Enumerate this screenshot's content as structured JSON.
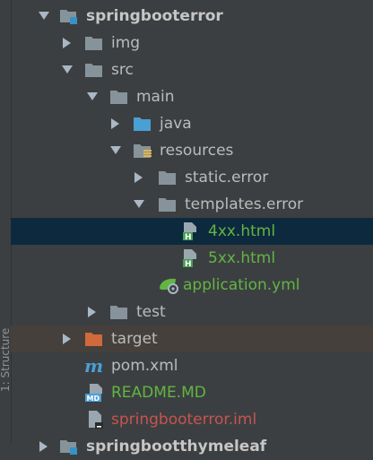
{
  "sidebar": {
    "label": "1: Structure"
  },
  "tree": {
    "root": "springbooterror",
    "img": "img",
    "src": "src",
    "main": "main",
    "java": "java",
    "resources": "resources",
    "static_error": "static.error",
    "templates_error": "templates.error",
    "file_4xx": "4xx.html",
    "file_5xx": "5xx.html",
    "application_yml": "application.yml",
    "test": "test",
    "target": "target",
    "pom": "pom.xml",
    "readme": "README.MD",
    "iml": "springbooterror.iml",
    "next_module": "springbootthymeleaf"
  },
  "colors": {
    "background": "#3c3f41",
    "selected_row": "#0d293e",
    "target_row": "#45403b",
    "folder": "#87939a",
    "source_folder": "#4a9fd5",
    "excluded_folder": "#d0693c",
    "html_file_text": "#62b543",
    "iml_text": "#c75450"
  }
}
